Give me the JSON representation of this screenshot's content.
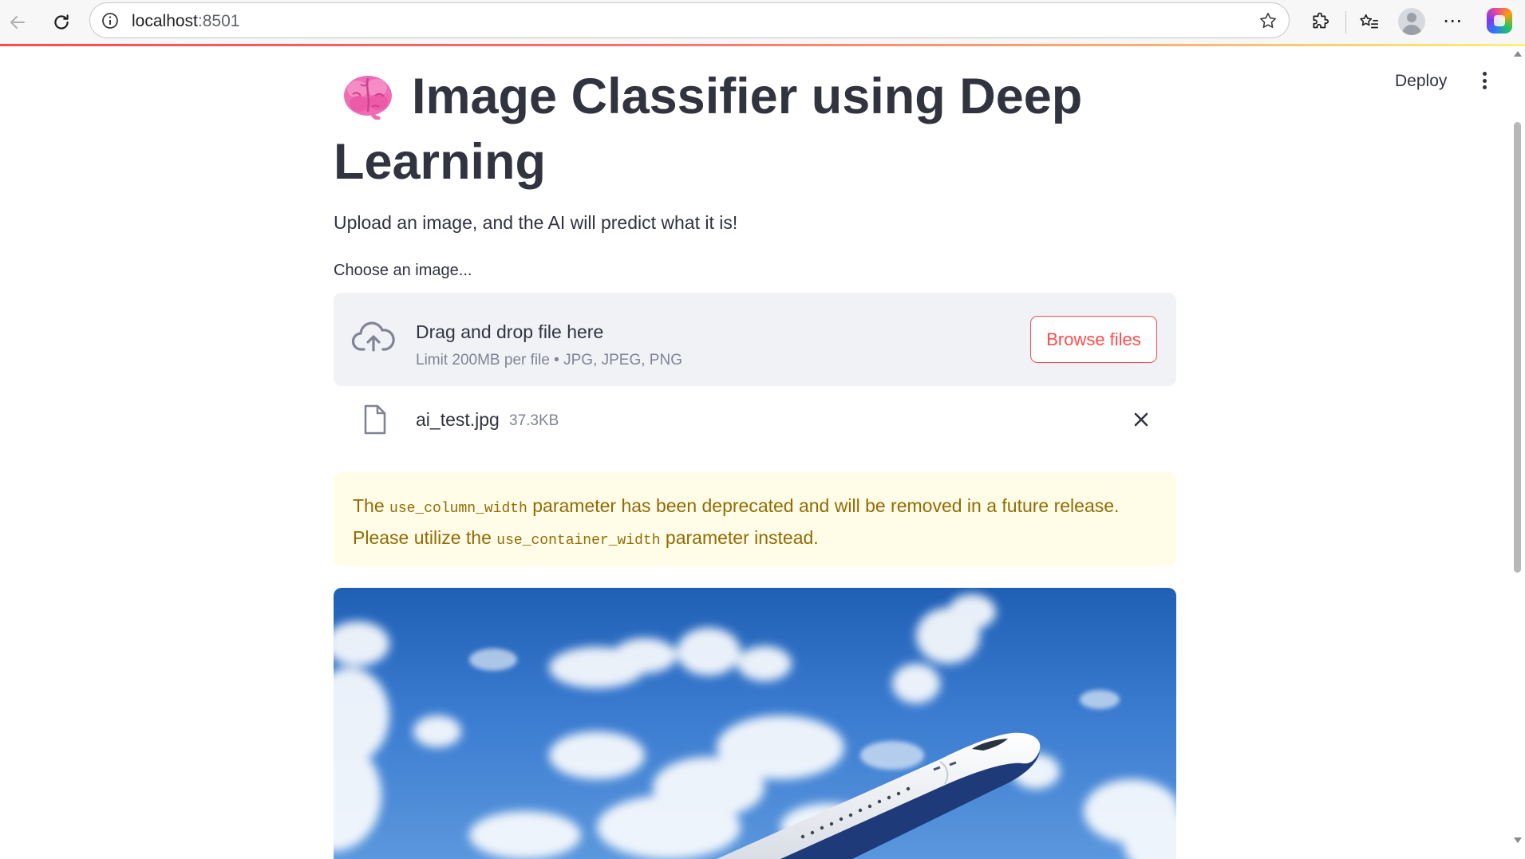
{
  "browser": {
    "url_host": "localhost",
    "url_port": ":8501"
  },
  "header": {
    "deploy_label": "Deploy"
  },
  "page": {
    "title": "Image Classifier using Deep Learning",
    "subtitle": "Upload an image, and the AI will predict what it is!"
  },
  "uploader": {
    "label": "Choose an image...",
    "drop_title": "Drag and drop file here",
    "limit_text": "Limit 200MB per file • JPG, JPEG, PNG",
    "browse_label": "Browse files",
    "file_name": "ai_test.jpg",
    "file_size": "37.3KB"
  },
  "warning": {
    "part1": "The ",
    "code1": "use_column_width",
    "part2": " parameter has been deprecated and will be removed in a future release. Please utilize the ",
    "code2": "use_container_width",
    "part3": " parameter instead."
  },
  "colors": {
    "accent": "#ff4b4b",
    "warning_bg": "#fffce7",
    "warning_text": "#926c05",
    "dropzone_bg": "#f0f2f6"
  },
  "icons": {
    "title_emoji": "brain-icon",
    "upload": "cloud-upload-icon",
    "file": "file-icon",
    "remove": "close-icon"
  }
}
